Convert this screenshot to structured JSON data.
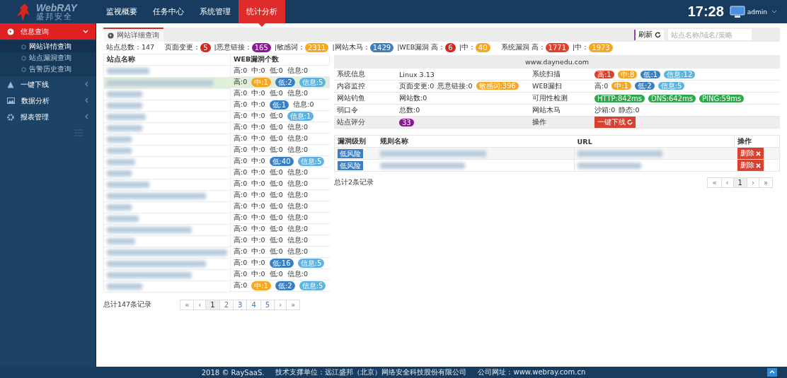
{
  "header": {
    "logo": {
      "brand": "WebRAY",
      "subtitle": "盛邦安全"
    },
    "nav": [
      {
        "label": "监视概要",
        "selected": false
      },
      {
        "label": "任务中心",
        "selected": false
      },
      {
        "label": "系统管理",
        "selected": false
      },
      {
        "label": "统计分析",
        "selected": true
      }
    ],
    "time": "17:28",
    "user": "admin"
  },
  "sidebar": {
    "items": [
      {
        "label": "信息查询",
        "expanded": true,
        "children": [
          {
            "label": "网站详情查询",
            "selected": true
          },
          {
            "label": "站点漏洞查询",
            "selected": false
          },
          {
            "label": "告警历史查询",
            "selected": false
          }
        ]
      },
      {
        "label": "一键下线",
        "expanded": false
      },
      {
        "label": "数据分析",
        "expanded": false
      },
      {
        "label": "报表管理",
        "expanded": false
      }
    ]
  },
  "tab": {
    "label": "网站详细查询",
    "selected": true
  },
  "toolbar": {
    "refresh": "刷新",
    "search": {
      "placeholder": "站点名称/域名/策略"
    }
  },
  "stats": [
    {
      "label": "站点总数：147"
    },
    {
      "label": "页面变更：",
      "badge": "5",
      "color": "#d9261c"
    },
    {
      "label": "|恶意链接：",
      "badge": "165",
      "color": "#8e1597"
    },
    {
      "label": "|敏感词：",
      "badge": "2311",
      "color": "#f5a623"
    },
    {
      "label": "|网站木马：",
      "badge": "1429",
      "color": "#3a7fc4"
    },
    {
      "label": "|WEB漏洞  高：",
      "badge": "6",
      "color": "#d9261c"
    },
    {
      "label": "|中：",
      "badge": "40",
      "color": "#f5a623"
    },
    {
      "label": "系统漏洞  高：",
      "badge": "1771",
      "color": "#e0402a"
    },
    {
      "label": "|中：",
      "badge": "1973",
      "color": "#f5a623"
    }
  ],
  "sites": {
    "columns": [
      "站点名称",
      "WEB漏洞个数"
    ],
    "rows": [
      {
        "selected": false,
        "counts": [
          {
            "text": "高:0"
          },
          {
            "text": "中:0"
          },
          {
            "text": "低:0"
          },
          {
            "text": "信息:0"
          }
        ]
      },
      {
        "selected": true,
        "counts": [
          {
            "text": "高:0"
          },
          {
            "text": "中:1",
            "color": "#f5a623"
          },
          {
            "text": "低:2",
            "color": "#3a7fc4"
          },
          {
            "text": "信息:5",
            "color": "#5bb3e0"
          }
        ]
      },
      {
        "selected": false,
        "counts": [
          {
            "text": "高:0"
          },
          {
            "text": "中:0"
          },
          {
            "text": "低:0"
          },
          {
            "text": "信息:0"
          }
        ]
      },
      {
        "selected": false,
        "counts": [
          {
            "text": "高:0"
          },
          {
            "text": "中:0"
          },
          {
            "text": "低:1",
            "color": "#3a7fc4"
          },
          {
            "text": "信息:0"
          }
        ]
      },
      {
        "selected": false,
        "counts": [
          {
            "text": "高:0"
          },
          {
            "text": "中:0"
          },
          {
            "text": "低:0"
          },
          {
            "text": "信息:1",
            "color": "#5bb3e0"
          }
        ]
      },
      {
        "selected": false,
        "counts": [
          {
            "text": "高:0"
          },
          {
            "text": "中:0"
          },
          {
            "text": "低:0"
          },
          {
            "text": "信息:0"
          }
        ]
      },
      {
        "selected": false,
        "counts": [
          {
            "text": "高:0"
          },
          {
            "text": "中:0"
          },
          {
            "text": "低:0"
          },
          {
            "text": "信息:0"
          }
        ]
      },
      {
        "selected": false,
        "counts": [
          {
            "text": "高:0"
          },
          {
            "text": "中:0"
          },
          {
            "text": "低:0"
          },
          {
            "text": "信息:0"
          }
        ]
      },
      {
        "selected": false,
        "counts": [
          {
            "text": "高:0"
          },
          {
            "text": "中:0"
          },
          {
            "text": "低:40",
            "color": "#3a7fc4"
          },
          {
            "text": "信息:5",
            "color": "#5bb3e0"
          }
        ]
      },
      {
        "selected": false,
        "counts": [
          {
            "text": "高:0"
          },
          {
            "text": "中:0"
          },
          {
            "text": "低:0"
          },
          {
            "text": "信息:0"
          }
        ]
      },
      {
        "selected": false,
        "counts": [
          {
            "text": "高:0"
          },
          {
            "text": "中:0"
          },
          {
            "text": "低:0"
          },
          {
            "text": "信息:0"
          }
        ]
      },
      {
        "selected": false,
        "counts": [
          {
            "text": "高:0"
          },
          {
            "text": "中:0"
          },
          {
            "text": "低:0"
          },
          {
            "text": "信息:0"
          }
        ]
      },
      {
        "selected": false,
        "counts": [
          {
            "text": "高:0"
          },
          {
            "text": "中:0"
          },
          {
            "text": "低:0"
          },
          {
            "text": "信息:0"
          }
        ]
      },
      {
        "selected": false,
        "counts": [
          {
            "text": "高:0"
          },
          {
            "text": "中:0"
          },
          {
            "text": "低:0"
          },
          {
            "text": "信息:0"
          }
        ]
      },
      {
        "selected": false,
        "counts": [
          {
            "text": "高:0"
          },
          {
            "text": "中:0"
          },
          {
            "text": "低:0"
          },
          {
            "text": "信息:0"
          }
        ]
      },
      {
        "selected": false,
        "counts": [
          {
            "text": "高:0"
          },
          {
            "text": "中:0"
          },
          {
            "text": "低:0"
          },
          {
            "text": "信息:0"
          }
        ]
      },
      {
        "selected": false,
        "counts": [
          {
            "text": "高:0"
          },
          {
            "text": "中:0"
          },
          {
            "text": "低:0"
          },
          {
            "text": "信息:0"
          }
        ]
      },
      {
        "selected": false,
        "counts": [
          {
            "text": "高:0"
          },
          {
            "text": "中:0"
          },
          {
            "text": "低:16",
            "color": "#3a7fc4"
          },
          {
            "text": "信息:5",
            "color": "#5bb3e0"
          }
        ]
      },
      {
        "selected": false,
        "counts": [
          {
            "text": "高:0"
          },
          {
            "text": "中:0"
          },
          {
            "text": "低:0"
          },
          {
            "text": "信息:0"
          }
        ]
      },
      {
        "selected": false,
        "counts": [
          {
            "text": "高:0"
          },
          {
            "text": "中:1",
            "color": "#f5a623"
          },
          {
            "text": "低:2",
            "color": "#3a7fc4"
          },
          {
            "text": "信息:5",
            "color": "#5bb3e0"
          }
        ]
      }
    ],
    "total": "总计147条记录",
    "pagination": [
      {
        "text": "«",
        "selected": false
      },
      {
        "text": "‹",
        "selected": false
      },
      {
        "text": "1",
        "selected": true
      },
      {
        "text": "2",
        "selected": false
      },
      {
        "text": "3",
        "selected": false
      },
      {
        "text": "4",
        "selected": false
      },
      {
        "text": "5",
        "selected": false
      },
      {
        "text": "›",
        "selected": false
      },
      {
        "text": "»",
        "selected": false
      }
    ]
  },
  "detail": {
    "title": "www.daynedu.com",
    "rows": [
      {
        "label": "系统信息",
        "value": [
          {
            "text": "Linux 3.13"
          }
        ],
        "label_2": "系统扫描",
        "value_2": [
          {
            "text": "高:1",
            "color": "#e0402a"
          },
          {
            "text": "中:8",
            "color": "#f5a623"
          },
          {
            "text": "低:1",
            "color": "#3a7fc4"
          },
          {
            "text": "信息:12",
            "color": "#5bb3e0"
          }
        ]
      },
      {
        "label": "内容监控",
        "value": [
          {
            "text": "页面变更:0"
          },
          {
            "text": "恶意链接:0"
          },
          {
            "text": "敏感词:396",
            "color": "#f5a623"
          }
        ],
        "label_2": "WEB漏扫",
        "value_2": [
          {
            "text": "高:0"
          },
          {
            "text": "中:1",
            "color": "#f5a623"
          },
          {
            "text": "低:2",
            "color": "#3a7fc4"
          },
          {
            "text": "信息:5",
            "color": "#5bb3e0"
          }
        ]
      },
      {
        "label": "网站钓鱼",
        "value": [
          {
            "text": "网站数:0"
          }
        ],
        "label_2": "可用性检测",
        "value_2": [
          {
            "text": "HTTP:842ms",
            "color": "#2ea84a"
          },
          {
            "text": "DNS:642ms",
            "color": "#2ea84a"
          },
          {
            "text": "PING:59ms",
            "color": "#2ea84a"
          }
        ]
      },
      {
        "label": "弱口令",
        "value": [
          {
            "text": "总数:0"
          }
        ],
        "label_2": "网站木马",
        "value_2": [
          {
            "text": "沙箱:0"
          },
          {
            "text": "静态:0"
          }
        ]
      },
      {
        "label": "站点评分",
        "value": [
          {
            "text": "33",
            "color": "#8e1597"
          }
        ],
        "label_2": "操作",
        "action": "一键下线"
      }
    ]
  },
  "vulns": {
    "columns": [
      "漏洞级别",
      "规则名称",
      "URL",
      "操作"
    ],
    "rows": [
      {
        "level": "低风险",
        "color": "#3a7fc4",
        "action": "删除"
      },
      {
        "level": "低风险",
        "color": "#3a7fc4",
        "action": "删除"
      }
    ],
    "total": "总计2条记录",
    "pagination": [
      {
        "text": "«",
        "selected": false
      },
      {
        "text": "‹",
        "selected": false
      },
      {
        "text": "1",
        "selected": true
      },
      {
        "text": "›",
        "selected": false
      },
      {
        "text": "»",
        "selected": false
      }
    ]
  },
  "footer": {
    "copyright": "2018 © RaySaaS.",
    "support": "技术支撑单位：远江盛邦（北京）网络安全科技股份有限公司",
    "website": "公司网址：www.webray.com.cn"
  }
}
